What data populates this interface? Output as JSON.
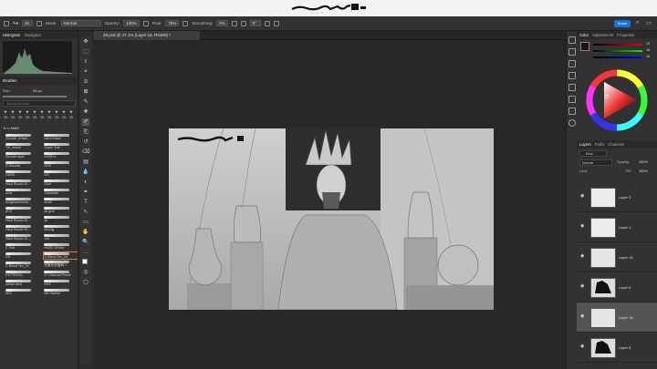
{
  "options": {
    "mode_label": "Mode:",
    "mode_value": "Normal",
    "opacity_label": "Opacity:",
    "opacity_value": "100%",
    "flow_label": "Flow:",
    "flow_value": "78%",
    "smoothing_label": "Smoothing:",
    "smoothing_value": "0%",
    "angle_value": "0°",
    "size_value": "25"
  },
  "share_label": "Share",
  "left": {
    "tabs": [
      "Histogram",
      "Navigator"
    ],
    "brushes_title": "Brushes",
    "size_label": "Size:",
    "size_value": "25 px",
    "search_placeholder": "Search Brushes",
    "preset_sizes": [
      "25",
      "25",
      "25",
      "25",
      "25",
      "25",
      "25",
      "25",
      "25",
      "25"
    ],
    "group_label": "MAIN",
    "brushes": [
      [
        "Smooth_eraser",
        "hard eraser"
      ],
      [
        "Txt_eraser",
        "Super Soft"
      ],
      [
        "Smooth style",
        "HARD s"
      ],
      [
        "G.Smooth",
        "DDS"
      ],
      [
        "HARD",
        "DS"
      ],
      [
        "Hard Round 30 ...",
        "Dust"
      ],
      [
        "cmic",
        "Oldstreak"
      ],
      [
        "Aufgesammene...",
        "erodi"
      ],
      [
        "ACE",
        "dk grsc"
      ],
      [
        "Hard Round 30 ...",
        "all"
      ],
      [
        "Hard Round 30 ...",
        "smudg"
      ],
      [
        "Hard Round 30 ...",
        "one"
      ],
      [
        "K-Text",
        "HARD DRAW"
      ],
      [
        "DD",
        "G.Blend Tex_04"
      ],
      [
        "G.Blend Tex_03",
        "鉛筆系統筆刷 1"
      ],
      [
        "DH PENCIL",
        "G Charcoal Pencil"
      ],
      [
        "sketch-kind",
        "KSS"
      ],
      [
        "kSS",
        "MK-Sketch"
      ]
    ]
  },
  "document": {
    "tab_title": "28.psd @ 47.1% (Layer 16, RGB/8) *"
  },
  "right": {
    "color_tabs": [
      "Color",
      "Adjustments",
      "Properties"
    ],
    "rgb_values": [
      "23",
      "16",
      "16"
    ],
    "layer_tabs": [
      "Layers",
      "Paths",
      "Channels"
    ],
    "kind_label": "Kind",
    "blend_mode": "Normal",
    "opacity_label": "Opacity:",
    "opacity_value": "100%",
    "lock_label": "Lock:",
    "fill_label": "Fill:",
    "fill_value": "100%",
    "layers": [
      {
        "name": "Layer 3"
      },
      {
        "name": "Layer 1"
      },
      {
        "name": "Layer 15"
      },
      {
        "name": "Layer 6"
      },
      {
        "name": "Layer 16"
      },
      {
        "name": "Layer 8"
      }
    ]
  },
  "colors": {
    "accent": "#1473e6",
    "selected_brush": "#d47a3c"
  }
}
